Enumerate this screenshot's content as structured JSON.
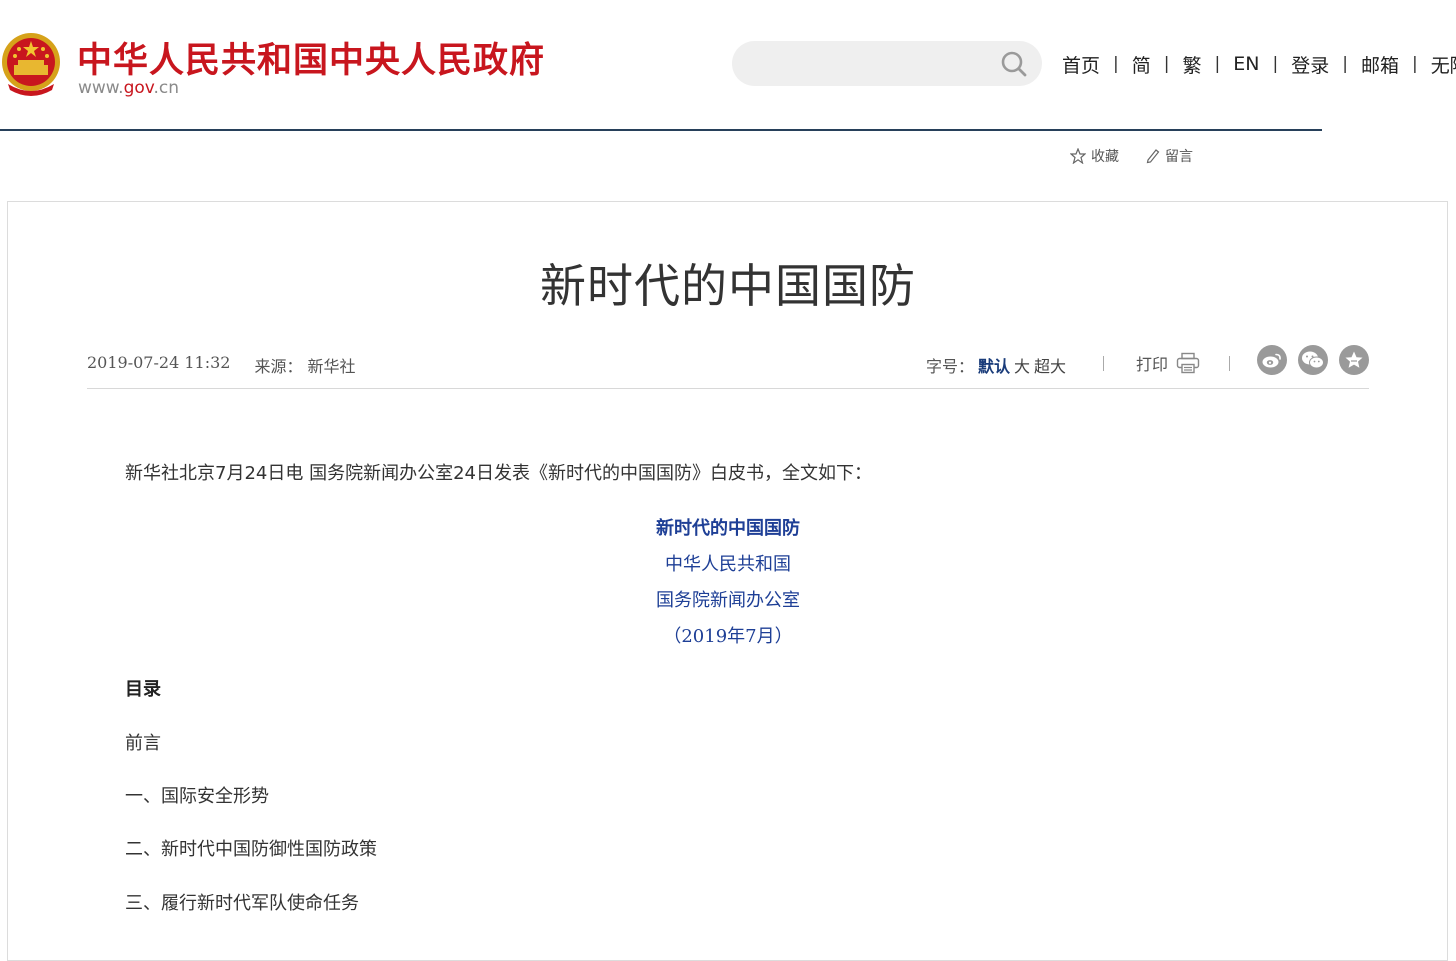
{
  "header": {
    "site_title": "中华人民共和国中央人民政府",
    "domain_prefix": "www.",
    "domain_highlight": "gov",
    "domain_suffix": ".cn",
    "search": {
      "placeholder": "",
      "value": ""
    },
    "nav": [
      "首页",
      "简",
      "繁",
      "EN",
      "登录",
      "邮箱",
      "无障碍"
    ],
    "nav_separator": "|",
    "brand_color": "#c8161e"
  },
  "utility": {
    "favorite_label": "收藏",
    "message_label": "留言"
  },
  "article": {
    "title": "新时代的中国国防",
    "date": "2019-07-24 11:32",
    "source": "来源： 新华社",
    "font_size": {
      "label": "字号：",
      "options": [
        "默认",
        "大",
        "超大"
      ],
      "selected": "默认"
    },
    "print_label": "打印",
    "share_icons": [
      "weibo-icon",
      "wechat-icon",
      "qzone-star-icon"
    ],
    "lead": "新华社北京7月24日电 国务院新闻办公室24日发表《新时代的中国国防》白皮书，全文如下：",
    "doc_header": [
      "新时代的中国国防",
      "中华人民共和国",
      "国务院新闻办公室",
      "（2019年7月）"
    ],
    "toc_title": "目录",
    "toc": [
      "前言",
      "一、国际安全形势",
      "二、新时代中国防御性国防政策",
      "三、履行新时代军队使命任务"
    ],
    "link_color": "#1e3f96"
  }
}
